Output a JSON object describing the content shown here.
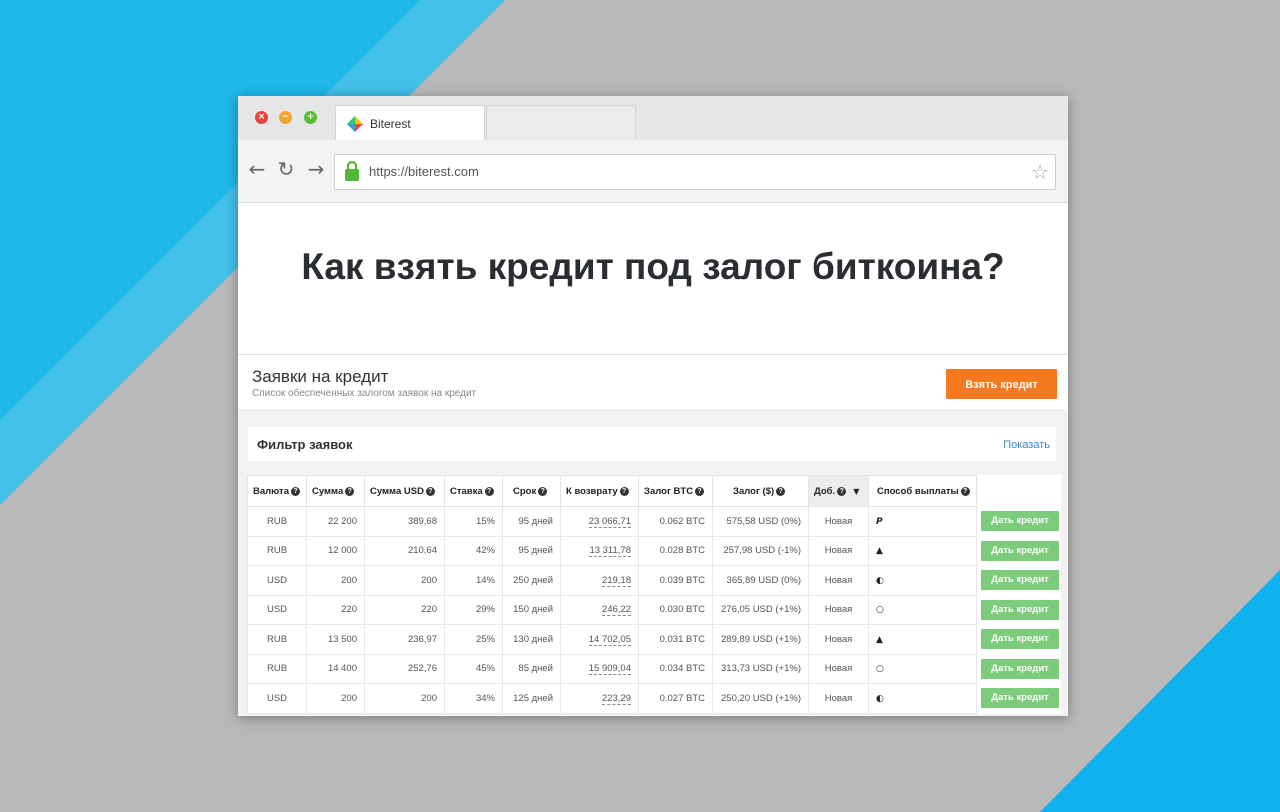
{
  "browser": {
    "tab_title": "Biterest",
    "url": "https://biterest.com"
  },
  "headline": "Как взять кредит под залог биткоина?",
  "page": {
    "title": "Заявки на кредит",
    "subtitle": "Список обеспеченных залогом заявок на кредит",
    "take_loan_label": "Взять кредит"
  },
  "filter": {
    "title": "Фильтр заявок",
    "show_label": "Показать"
  },
  "table": {
    "headers": [
      "Валюта",
      "Сумма",
      "Сумма USD",
      "Ставка",
      "Срок",
      "К возврату",
      "Залог BTC",
      "Залог ($)",
      "Доб.",
      "Способ выплаты"
    ],
    "action_label": "Дать кредит",
    "rows": [
      {
        "currency": "RUB",
        "amount": "22 200",
        "amount_usd": "389,68",
        "rate": "15%",
        "term": "95 дней",
        "return": "23 066,71",
        "btc": "0.062 BTC",
        "collateral": "575,58 USD (0%)",
        "status": "Новая",
        "pay_icon": "paypal-icon"
      },
      {
        "currency": "RUB",
        "amount": "12 000",
        "amount_usd": "210,64",
        "rate": "42%",
        "term": "95 дней",
        "return": "13 311,78",
        "btc": "0.028 BTC",
        "collateral": "257,98 USD (-1%)",
        "status": "Новая",
        "pay_icon": "bank-icon"
      },
      {
        "currency": "USD",
        "amount": "200",
        "amount_usd": "200",
        "rate": "14%",
        "term": "250 дней",
        "return": "219,18",
        "btc": "0.039 BTC",
        "collateral": "365,89 USD (0%)",
        "status": "Новая",
        "pay_icon": "half-circle-icon"
      },
      {
        "currency": "USD",
        "amount": "220",
        "amount_usd": "220",
        "rate": "29%",
        "term": "150 дней",
        "return": "246,22",
        "btc": "0.030 BTC",
        "collateral": "276,05 USD (+1%)",
        "status": "Новая",
        "pay_icon": "ring-icon"
      },
      {
        "currency": "RUB",
        "amount": "13 500",
        "amount_usd": "236,97",
        "rate": "25%",
        "term": "130 дней",
        "return": "14 702,05",
        "btc": "0.031 BTC",
        "collateral": "289,89 USD (+1%)",
        "status": "Новая",
        "pay_icon": "bank-icon"
      },
      {
        "currency": "RUB",
        "amount": "14 400",
        "amount_usd": "252,76",
        "rate": "45%",
        "term": "85 дней",
        "return": "15 909,04",
        "btc": "0.034 BTC",
        "collateral": "313,73 USD (+1%)",
        "status": "Новая",
        "pay_icon": "ring-icon"
      },
      {
        "currency": "USD",
        "amount": "200",
        "amount_usd": "200",
        "rate": "34%",
        "term": "125 дней",
        "return": "223,29",
        "btc": "0.027 BTC",
        "collateral": "250,20 USD (+1%)",
        "status": "Новая",
        "pay_icon": "half-circle-icon"
      }
    ]
  },
  "colors": {
    "accent_orange": "#f47920",
    "action_green": "#7ccc7c",
    "bg_blue": "#1fb8ea",
    "bg_gray": "#b9b9b9"
  }
}
